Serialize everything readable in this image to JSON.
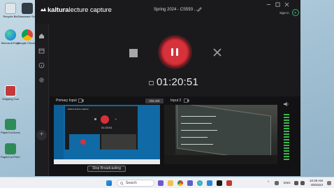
{
  "desktop": {
    "icons": [
      {
        "label": "Recycle Bin",
        "color": "#cfd8de"
      },
      {
        "label": "Microsoft Edge",
        "color": "#1f8ed6"
      },
      {
        "label": "Snipping Tool",
        "color": "#c23a3a"
      },
      {
        "label": "PaperCut Account",
        "color": "#2e8b57"
      },
      {
        "label": "PaperCut Print Release",
        "color": "#2e8b57"
      },
      {
        "label": "Glassware Screen Share",
        "color": "#333b44"
      },
      {
        "label": "Google Chrome",
        "color": "#e0a82e"
      }
    ]
  },
  "app": {
    "logo_brand": "kaltura",
    "logo_product": "lecture capture",
    "session_title": "Spring 2024 - CS593 ...",
    "sign_in": "Sign in",
    "timer": "01:20:51",
    "primary_input_label": "Primary Input",
    "input2_label": "Input 2",
    "on_air": "ON AIR",
    "stop_broadcasting": "Stop Broadcasting",
    "thumb_timer": "01:20:51",
    "accent": "#d5323c",
    "meter_color": "#3bb84a"
  },
  "taskbar": {
    "search_placeholder": "Search",
    "lang": "ENG",
    "time": "10:29 AM",
    "date": "4/9/2024"
  }
}
